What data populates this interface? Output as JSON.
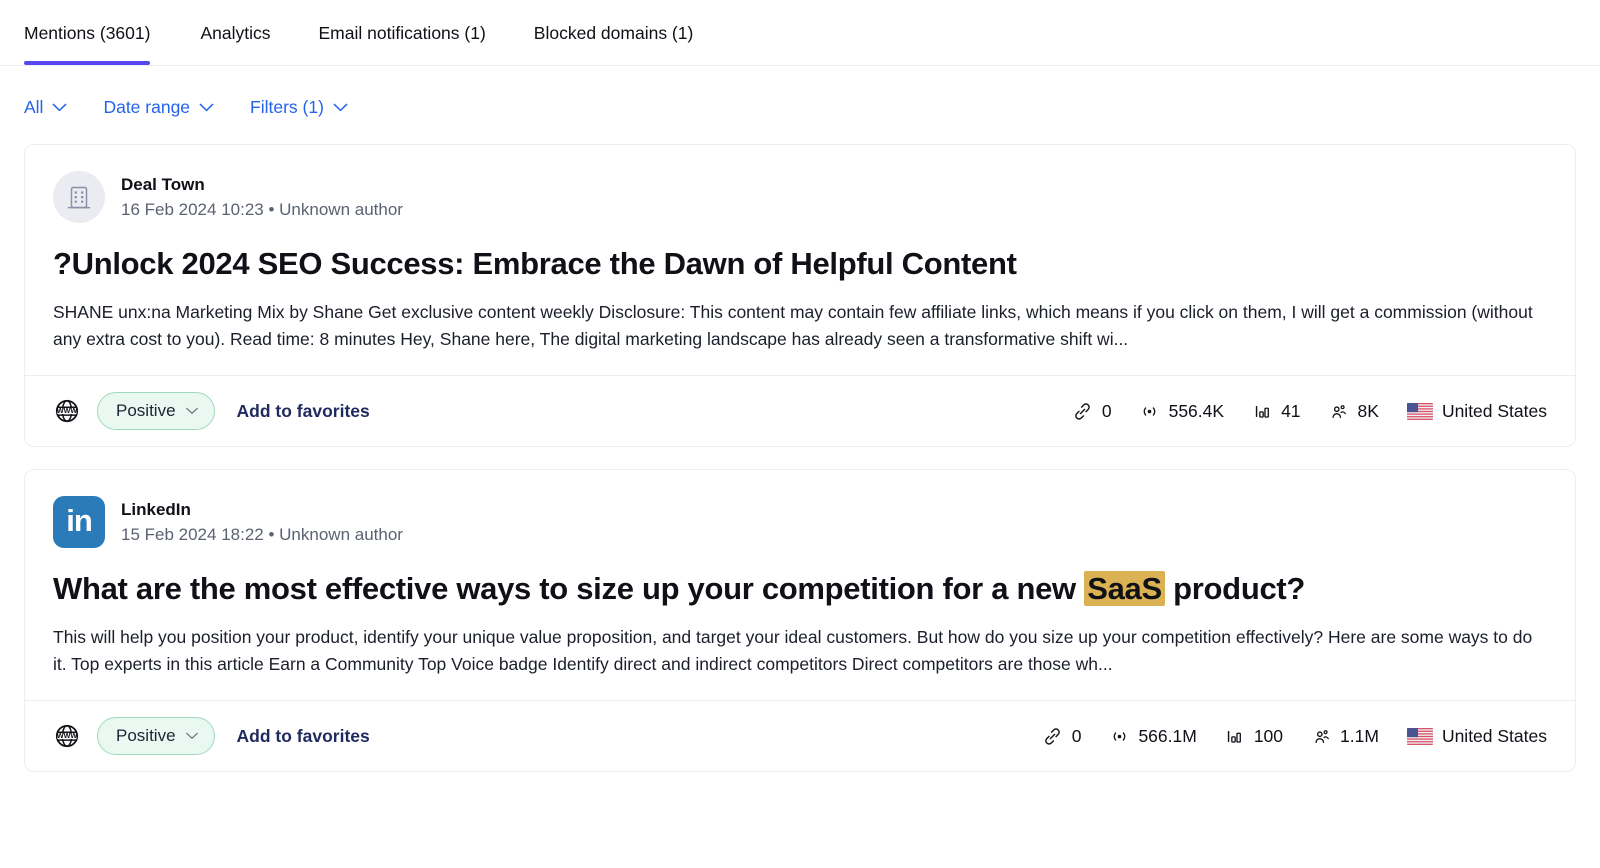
{
  "tabs": [
    {
      "label": "Mentions (3601)",
      "active": true
    },
    {
      "label": "Analytics",
      "active": false
    },
    {
      "label": "Email notifications (1)",
      "active": false
    },
    {
      "label": "Blocked domains (1)",
      "active": false
    }
  ],
  "filters": [
    {
      "label": "All",
      "icon": "chevron-down-icon"
    },
    {
      "label": "Date range",
      "icon": "chevron-down-icon"
    },
    {
      "label": "Filters (1)",
      "icon": "chevron-down-icon"
    }
  ],
  "colors": {
    "active_tab_underline": "#5647f2",
    "filter_link": "#2563eb",
    "highlight": "#dbb253",
    "sentiment_positive_bg": "#e9f8f0",
    "sentiment_positive_border": "#9fd9bb",
    "card_border": "#eceef2"
  },
  "mentions": [
    {
      "source_name": "Deal Town",
      "source_icon": "building-icon",
      "timestamp": "16 Feb 2024 10:23",
      "separator": "•",
      "author": "Unknown author",
      "title_prefix": "?Unlock 2024 SEO Success: Embrace the Dawn of Helpful Content",
      "title_highlight": "",
      "title_suffix": "",
      "snippet": "SHANE unx:na Marketing Mix by Shane Get exclusive content weekly Disclosure: This content may contain few affiliate links, which means if you click on them, I will get a commission (without any extra cost to you). Read time: 8 minutes Hey, Shane here, The digital marketing landscape has already seen a transformative shift wi...",
      "domain_icon": "www-globe-icon",
      "sentiment": "Positive",
      "favorites_label": "Add to favorites",
      "metrics": [
        {
          "icon": "link-icon",
          "value": "0"
        },
        {
          "icon": "signal-icon",
          "value": "556.4K"
        },
        {
          "icon": "bar-chart-icon",
          "value": "41"
        },
        {
          "icon": "users-icon",
          "value": "8K"
        }
      ],
      "country": "United States",
      "country_flag": "us-flag-icon"
    },
    {
      "source_name": "LinkedIn",
      "source_icon": "linkedin-icon",
      "timestamp": "15 Feb 2024 18:22",
      "separator": "•",
      "author": "Unknown author",
      "title_prefix": "What are the most effective ways to size up your competition for a new ",
      "title_highlight": "SaaS",
      "title_suffix": " product?",
      "snippet": "This will help you position your product, identify your unique value proposition, and target your ideal customers. But how do you size up your competition effectively? Here are some ways to do it. Top experts in this article Earn a Community Top Voice badge Identify direct and indirect competitors Direct competitors are those wh...",
      "domain_icon": "www-globe-icon",
      "sentiment": "Positive",
      "favorites_label": "Add to favorites",
      "metrics": [
        {
          "icon": "link-icon",
          "value": "0"
        },
        {
          "icon": "signal-icon",
          "value": "566.1M"
        },
        {
          "icon": "bar-chart-icon",
          "value": "100"
        },
        {
          "icon": "users-icon",
          "value": "1.1M"
        }
      ],
      "country": "United States",
      "country_flag": "us-flag-icon"
    }
  ],
  "linkedin_glyph": "in"
}
